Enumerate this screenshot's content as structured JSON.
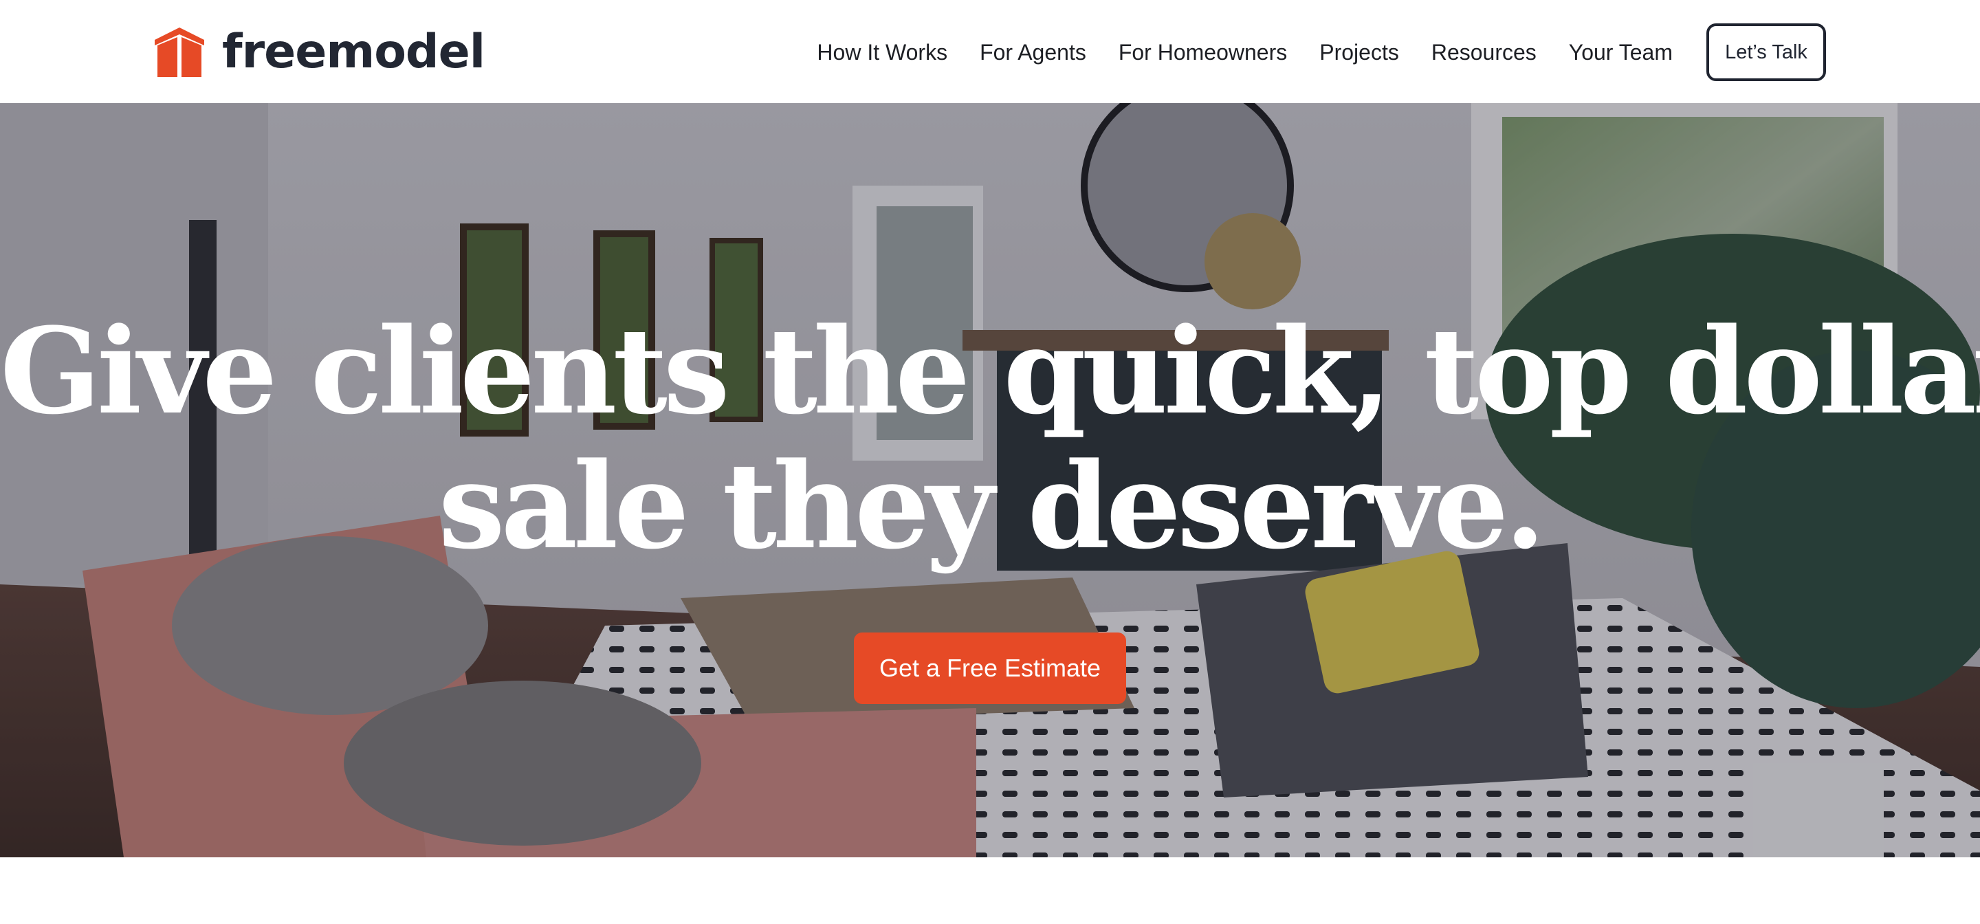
{
  "brand": {
    "name": "freemodel",
    "accent": "#e64a26",
    "ink": "#222733"
  },
  "nav": {
    "links": [
      "How It Works",
      "For Agents",
      "For Homeowners",
      "Projects",
      "Resources",
      "Your Team"
    ],
    "cta_label": "Let’s Talk"
  },
  "hero": {
    "headline_line1": "Give clients the quick, top dollar",
    "headline_line2": "sale they deserve.",
    "cta_label": "Get a Free Estimate",
    "background_icon": "living-room-photo"
  }
}
